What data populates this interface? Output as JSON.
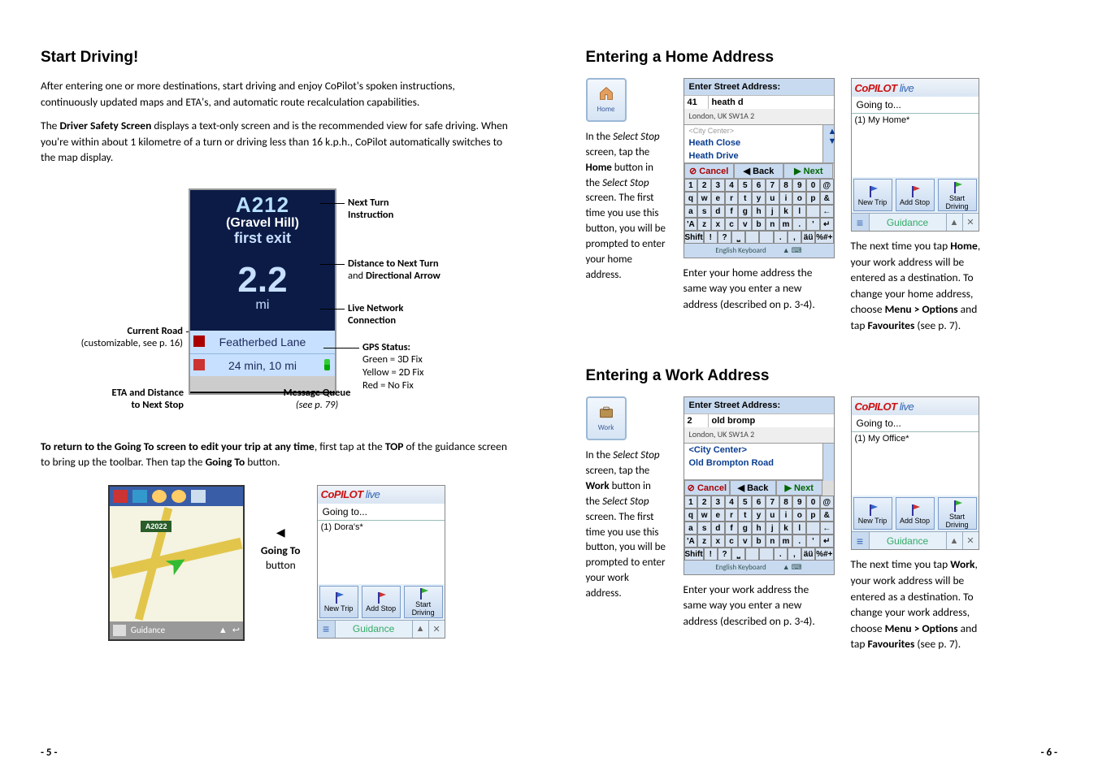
{
  "left": {
    "heading": "Start Driving!",
    "p1": "After entering one or more destinations, start driving and enjoy CoPilot's spoken instructions, continuously updated maps and ETA's, and automatic route recalculation capabilities.",
    "p2_a": "The ",
    "p2_b": "Driver Safety Screen",
    "p2_c": " displays a text-only screen and is the recommended view for safe driving. When you're within about 1 kilometre of a turn or driving less than 16 k.p.h., CoPilot automatically switches to the map display.",
    "callouts": {
      "next_turn_a": "Next Turn",
      "next_turn_b": "Instruction",
      "distance_a": "Distance to Next Turn",
      "distance_b": "and ",
      "distance_c": "Directional Arrow",
      "live_a": "Live Network",
      "live_b": "Connection",
      "gps_h": "GPS Status:",
      "gps_g": "Green = 3D Fix",
      "gps_y": "Yellow = 2D Fix",
      "gps_r": "Red = No Fix",
      "msg_a": "Message Queue",
      "msg_b": "(see p. 79)",
      "eta_a": "ETA and Distance",
      "eta_b": "to Next Stop",
      "cur_a": "Current Road",
      "cur_b": "(customizable, see p. 16)"
    },
    "screen": {
      "road_big": "A212",
      "road_sub": "(Gravel Hill)",
      "exit": "first exit",
      "dist": "2.2",
      "unit": "mi",
      "cur": "Featherbed Lane",
      "eta": "24 min, 10 mi"
    },
    "p3_a": "To return to the Going To screen to edit your trip at any time",
    "p3_b": ", first tap at the ",
    "p3_c": "TOP",
    "p3_d": " of the guidance screen to bring up the toolbar. Then tap the ",
    "p3_e": "Going To",
    "p3_f": " button.",
    "goto_label_a": "Going To",
    "goto_label_b": "button",
    "road_label": "A2022",
    "guidance_text": "Guidance",
    "cp": {
      "logo1": "CoPILOT",
      "logo2": " live",
      "going": "Going to...",
      "item": "(1) Dora's*",
      "tab1": "New Trip",
      "tab2": "Add Stop",
      "tab3": "Start Driving",
      "bottom": "Guidance"
    },
    "page_num": "- 5 -"
  },
  "right": {
    "heading1": "Entering a Home Address",
    "home_btn": "Home",
    "col1_a": "In the ",
    "col1_b": "Select Stop",
    "col1_c": " screen, tap the ",
    "col1_d": "Home",
    "col1_e": " button in the ",
    "col1_f": "Select Stop",
    "col1_g": " screen.  The first time you use this button, you will be prompted to enter your home address.",
    "kb_home": {
      "head": "Enter Street Address:",
      "num": "41",
      "street": "heath d",
      "city": "London, UK SW1A 2",
      "sug0": "<City Center>",
      "sug1": "Heath Close",
      "sug2": "Heath Drive",
      "cancel": "Cancel",
      "back": "Back",
      "next": "Next",
      "foot": "English Keyboard"
    },
    "col2_home": "Enter your home address the same way you enter a new address (described on p. 3-4).",
    "cp_home": {
      "going": "Going to...",
      "item": "(1) My Home*"
    },
    "col3_home_a": "The next time you tap ",
    "col3_home_b": "Home",
    "col3_home_c": ", your work address will be entered as a destination. To change your home address, choose ",
    "col3_home_d": "Menu > Options",
    "col3_home_e": " and tap ",
    "col3_home_f": "Favourites",
    "col3_home_g": " (see p. 7).",
    "heading2": "Entering a Work Address",
    "work_btn": "Work",
    "col1w_d": "Work",
    "col1w_g": " screen.  The first time you use this button, you will be prompted to enter your work address.",
    "kb_work": {
      "num": "2",
      "street": "old bromp",
      "sug0": "<City Center>",
      "sug1": "Old Brompton Road"
    },
    "col2_work": "Enter your work address the same way you enter a new address (described on p. 3-4).",
    "cp_work": {
      "item": "(1) My Office*"
    },
    "col3_work_a": "The next time you tap ",
    "col3_work_b": "Work",
    "col3_work_c": ", your work address will be entered as a destination. To change your work address, choose ",
    "col3_work_d": "Menu > Options",
    "col3_work_e": " and tap ",
    "col3_work_f": "Favourites",
    "col3_work_g": " (see p. 7).",
    "keys": {
      "r1": [
        "1",
        "2",
        "3",
        "4",
        "5",
        "6",
        "7",
        "8",
        "9",
        "0",
        "@"
      ],
      "r2": [
        "q",
        "w",
        "e",
        "r",
        "t",
        "y",
        "u",
        "i",
        "o",
        "p",
        "&"
      ],
      "r3": [
        "a",
        "s",
        "d",
        "f",
        "g",
        "h",
        "j",
        "k",
        "l",
        "",
        "←"
      ],
      "r4": [
        "'A",
        "z",
        "x",
        "c",
        "v",
        "b",
        "n",
        "m",
        ".",
        "'",
        "↵"
      ],
      "r5": [
        "Shift",
        "!",
        "?",
        "⎵",
        "",
        "",
        ".",
        ",",
        "äü",
        "%#+"
      ]
    },
    "page_num": "- 6 -"
  }
}
